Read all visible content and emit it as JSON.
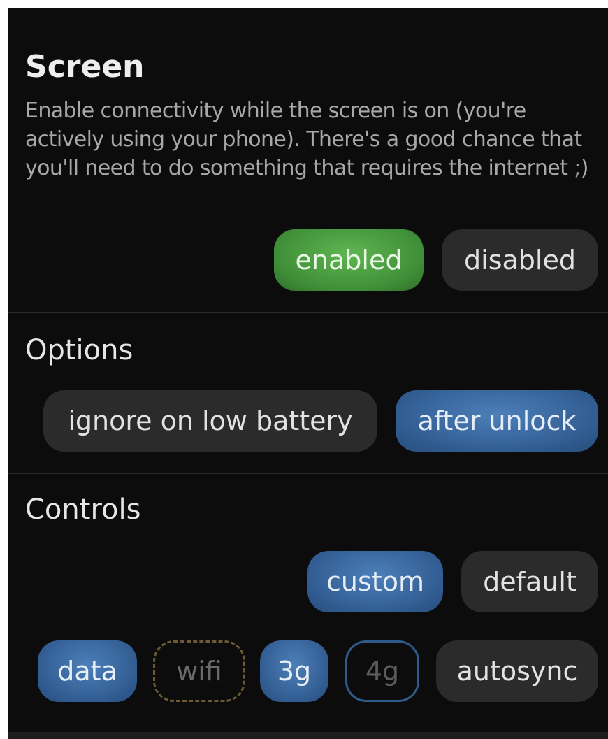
{
  "screen": {
    "title": "Screen",
    "description": "Enable connectivity while the screen is on (you're actively using your phone). There's a good chance that you'll need to do something that requires the internet ;)",
    "enabled_label": "enabled",
    "disabled_label": "disabled",
    "state": "enabled"
  },
  "options": {
    "title": "Options",
    "ignore_low_battery_label": "ignore on low battery",
    "after_unlock_label": "after unlock",
    "active": [
      "after unlock"
    ]
  },
  "controls": {
    "title": "Controls",
    "custom_label": "custom",
    "default_label": "default",
    "mode": "custom",
    "toggles": {
      "data": "data",
      "wifi": "wifi",
      "g3": "3g",
      "g4": "4g",
      "autosync": "autosync"
    }
  },
  "colors": {
    "enabled_green": "#3f8e38",
    "active_blue": "#335f95",
    "inactive_dark": "#2a2b2a",
    "background": "#0c0c0c"
  }
}
